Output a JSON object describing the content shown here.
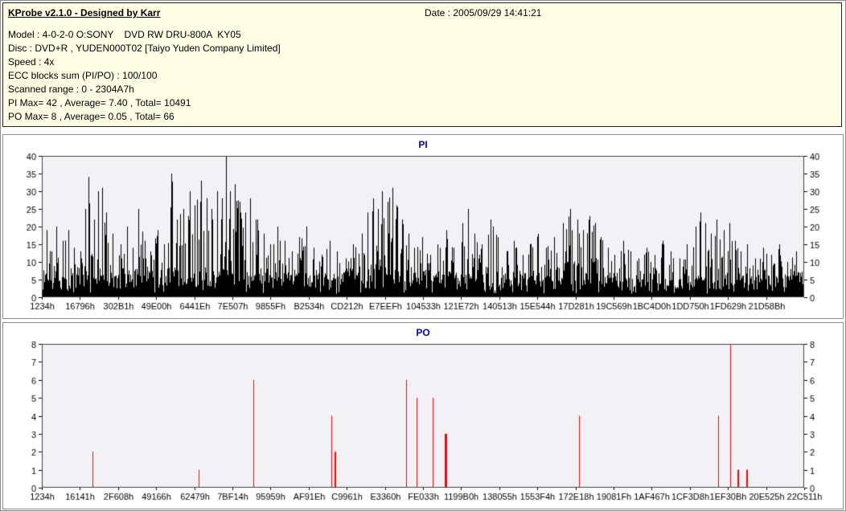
{
  "header": {
    "app_title": "KProbe v2.1.0 - Designed by Karr",
    "date_label": "Date : 2005/09/29 14:41:21"
  },
  "info": {
    "model": "Model : 4-0-2-0 O:SONY    DVD RW DRU-800A  KY05",
    "disc": "Disc : DVD+R , YUDEN000T02 [Taiyo Yuden Company Limited]",
    "speed": "Speed : 4x",
    "ecc_blocks": "ECC blocks sum (PI/PO) : 100/100",
    "scanned_range": "Scanned range : 0 - 2304A7h",
    "pi_summary": "PI Max= 42 , Average= 7.40 , Total= 10491",
    "po_summary": "PO Max= 8 , Average= 0.05 , Total= 66"
  },
  "chart_data": [
    {
      "type": "bar",
      "name": "PI",
      "title": "PI",
      "title_color": "#0000cc",
      "bar_color": "#000000",
      "plot_bg": "#f2f2f6",
      "axis_color": "#404040",
      "xlabel": "",
      "ylabel": "",
      "ylim": [
        0,
        40
      ],
      "yticks": [
        0,
        5,
        10,
        15,
        20,
        25,
        30,
        35,
        40
      ],
      "grid": false,
      "legend": "none",
      "stats": {
        "max": 42,
        "average": 7.4,
        "total": 10491
      },
      "x_tick_labels": [
        "1234h",
        "16796h",
        "302B1h",
        "49E00h",
        "6441Eh",
        "7E507h",
        "9855Fh",
        "B2534h",
        "CD212h",
        "E7EEFh",
        "104533h",
        "121E72h",
        "140513h",
        "15E544h",
        "17D281h",
        "19C569h",
        "1BC4D0h",
        "1DD750h",
        "1FD629h",
        "21D58Bh"
      ],
      "envelope": [
        [
          0.0,
          8
        ],
        [
          0.006,
          19
        ],
        [
          0.013,
          13
        ],
        [
          0.019,
          20
        ],
        [
          0.027,
          16
        ],
        [
          0.035,
          19
        ],
        [
          0.042,
          14
        ],
        [
          0.051,
          13
        ],
        [
          0.057,
          25
        ],
        [
          0.061,
          34
        ],
        [
          0.069,
          22
        ],
        [
          0.074,
          30
        ],
        [
          0.079,
          31
        ],
        [
          0.085,
          24
        ],
        [
          0.093,
          18
        ],
        [
          0.103,
          15
        ],
        [
          0.112,
          20
        ],
        [
          0.119,
          14
        ],
        [
          0.127,
          25
        ],
        [
          0.135,
          16
        ],
        [
          0.143,
          13
        ],
        [
          0.152,
          19
        ],
        [
          0.161,
          15
        ],
        [
          0.17,
          35
        ],
        [
          0.177,
          22
        ],
        [
          0.186,
          25
        ],
        [
          0.194,
          30
        ],
        [
          0.201,
          26
        ],
        [
          0.209,
          33
        ],
        [
          0.216,
          28
        ],
        [
          0.223,
          25
        ],
        [
          0.23,
          30
        ],
        [
          0.237,
          28
        ],
        [
          0.242,
          42
        ],
        [
          0.247,
          30
        ],
        [
          0.253,
          32
        ],
        [
          0.26,
          27
        ],
        [
          0.267,
          24
        ],
        [
          0.274,
          28
        ],
        [
          0.283,
          22
        ],
        [
          0.291,
          18
        ],
        [
          0.3,
          15
        ],
        [
          0.309,
          20
        ],
        [
          0.319,
          16
        ],
        [
          0.328,
          13
        ],
        [
          0.338,
          17
        ],
        [
          0.347,
          20
        ],
        [
          0.357,
          14
        ],
        [
          0.367,
          12
        ],
        [
          0.378,
          16
        ],
        [
          0.388,
          13
        ],
        [
          0.399,
          11
        ],
        [
          0.409,
          15
        ],
        [
          0.42,
          18
        ],
        [
          0.428,
          24
        ],
        [
          0.435,
          28
        ],
        [
          0.441,
          25
        ],
        [
          0.447,
          30
        ],
        [
          0.454,
          27
        ],
        [
          0.46,
          31
        ],
        [
          0.466,
          26
        ],
        [
          0.473,
          22
        ],
        [
          0.481,
          18
        ],
        [
          0.489,
          14
        ],
        [
          0.499,
          17
        ],
        [
          0.51,
          12
        ],
        [
          0.52,
          15
        ],
        [
          0.531,
          19
        ],
        [
          0.541,
          14
        ],
        [
          0.552,
          21
        ],
        [
          0.56,
          25
        ],
        [
          0.568,
          18
        ],
        [
          0.578,
          15
        ],
        [
          0.589,
          22
        ],
        [
          0.599,
          17
        ],
        [
          0.61,
          13
        ],
        [
          0.62,
          16
        ],
        [
          0.631,
          12
        ],
        [
          0.641,
          15
        ],
        [
          0.652,
          18
        ],
        [
          0.662,
          14
        ],
        [
          0.673,
          17
        ],
        [
          0.684,
          21
        ],
        [
          0.694,
          25
        ],
        [
          0.703,
          22
        ],
        [
          0.711,
          19
        ],
        [
          0.719,
          23
        ],
        [
          0.726,
          21
        ],
        [
          0.734,
          17
        ],
        [
          0.743,
          14
        ],
        [
          0.752,
          12
        ],
        [
          0.763,
          16
        ],
        [
          0.773,
          13
        ],
        [
          0.784,
          11
        ],
        [
          0.794,
          14
        ],
        [
          0.805,
          12
        ],
        [
          0.815,
          16
        ],
        [
          0.826,
          13
        ],
        [
          0.837,
          11
        ],
        [
          0.847,
          15
        ],
        [
          0.858,
          20
        ],
        [
          0.865,
          24
        ],
        [
          0.871,
          21
        ],
        [
          0.879,
          18
        ],
        [
          0.886,
          22
        ],
        [
          0.895,
          19
        ],
        [
          0.903,
          21
        ],
        [
          0.91,
          16
        ],
        [
          0.918,
          13
        ],
        [
          0.926,
          15
        ],
        [
          0.937,
          11
        ],
        [
          0.947,
          14
        ],
        [
          0.958,
          12
        ],
        [
          0.968,
          15
        ],
        [
          0.979,
          10
        ],
        [
          0.99,
          13
        ],
        [
          1.0,
          9
        ]
      ],
      "noise": {
        "seed": 1337,
        "base_min": 1,
        "base_max": 7,
        "spike_pow": 2.8
      }
    },
    {
      "type": "bar",
      "name": "PO",
      "title": "PO",
      "title_color": "#0000cc",
      "bar_color": "#ff0000",
      "plot_bg": "#f2f2f6",
      "axis_color": "#404040",
      "xlabel": "",
      "ylabel": "",
      "ylim": [
        0,
        8
      ],
      "yticks": [
        0,
        1,
        2,
        3,
        4,
        5,
        6,
        7,
        8
      ],
      "grid": false,
      "legend": "none",
      "stats": {
        "max": 8,
        "average": 0.05,
        "total": 66
      },
      "x_tick_labels": [
        "1234h",
        "16141h",
        "2F608h",
        "49166h",
        "62479h",
        "7BF14h",
        "95959h",
        "AF91Eh",
        "C9961h",
        "E3360h",
        "FE033h",
        "1199B0h",
        "138055h",
        "1553F4h",
        "172E18h",
        "19081Fh",
        "1AF467h",
        "1CF3D8h",
        "1EF30Bh",
        "20E525h",
        "22C511h"
      ],
      "spikes": [
        {
          "x": 0.066,
          "v": 2
        },
        {
          "x": 0.206,
          "v": 1
        },
        {
          "x": 0.277,
          "v": 6
        },
        {
          "x": 0.38,
          "v": 4
        },
        {
          "x": 0.384,
          "v": 2,
          "w": 2
        },
        {
          "x": 0.478,
          "v": 6
        },
        {
          "x": 0.492,
          "v": 5
        },
        {
          "x": 0.513,
          "v": 5
        },
        {
          "x": 0.528,
          "v": 3,
          "w": 3
        },
        {
          "x": 0.705,
          "v": 4
        },
        {
          "x": 0.887,
          "v": 4
        },
        {
          "x": 0.903,
          "v": 8
        },
        {
          "x": 0.912,
          "v": 1,
          "w": 2
        },
        {
          "x": 0.924,
          "v": 1,
          "w": 2
        }
      ]
    }
  ]
}
